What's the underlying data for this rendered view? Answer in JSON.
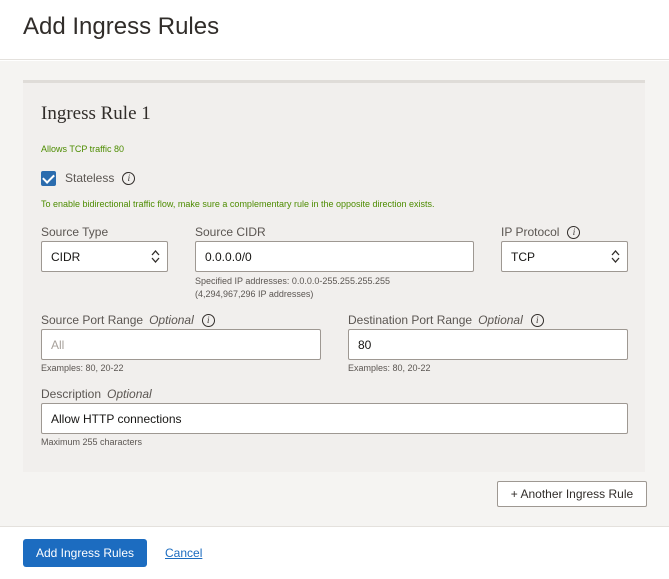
{
  "header": {
    "title": "Add Ingress Rules"
  },
  "rule": {
    "title": "Ingress Rule 1",
    "summary": "Allows TCP traffic 80",
    "stateless": {
      "label": "Stateless",
      "checked": true
    },
    "stateless_note": "To enable bidirectional traffic flow, make sure a complementary rule in the opposite direction exists.",
    "source_type": {
      "label": "Source Type",
      "value": "CIDR"
    },
    "source_cidr": {
      "label": "Source CIDR",
      "value": "0.0.0.0/0",
      "help_line1": "Specified IP addresses: 0.0.0.0-255.255.255.255",
      "help_line2": "(4,294,967,296 IP addresses)"
    },
    "ip_protocol": {
      "label": "IP Protocol",
      "value": "TCP"
    },
    "source_port": {
      "label": "Source Port Range",
      "optional": "Optional",
      "placeholder": "All",
      "value": "",
      "help": "Examples: 80, 20-22"
    },
    "dest_port": {
      "label": "Destination Port Range",
      "optional": "Optional",
      "value": "80",
      "help": "Examples: 80, 20-22"
    },
    "description": {
      "label": "Description",
      "optional": "Optional",
      "value": "Allow HTTP connections",
      "help": "Maximum 255 characters"
    }
  },
  "actions": {
    "another_rule": "+ Another Ingress Rule",
    "submit": "Add Ingress Rules",
    "cancel": "Cancel"
  },
  "colors": {
    "primary": "#1c6cc0",
    "success_text": "#4d8c00",
    "checkbox": "#2b6cae"
  },
  "icons": {
    "info": "info-icon",
    "select": "select-arrows-icon",
    "check": "checkmark-icon"
  }
}
